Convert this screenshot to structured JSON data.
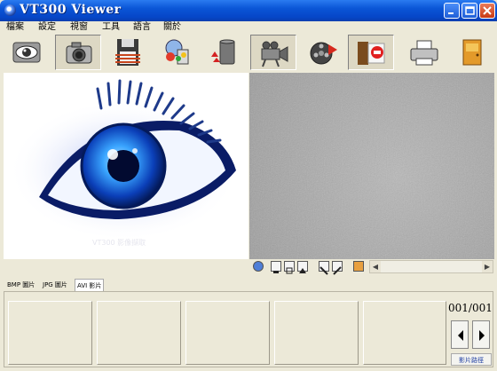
{
  "window": {
    "title": "VT300 Viewer"
  },
  "menu": [
    "檔案",
    "設定",
    "視窗",
    "工具",
    "語言",
    "關於"
  ],
  "toolbar": {
    "tools": [
      {
        "icon": "eye-view-icon",
        "pressed": false
      },
      {
        "icon": "camera-icon",
        "pressed": true
      },
      {
        "icon": "floppy-disk-icon",
        "pressed": false
      },
      {
        "icon": "recycle-bin-icon",
        "pressed": false
      },
      {
        "icon": "movie-camera-icon",
        "pressed": true
      },
      {
        "icon": "film-record-icon",
        "pressed": false
      },
      {
        "icon": "film-stop-icon",
        "pressed": true
      },
      {
        "icon": "printer-icon",
        "pressed": false
      },
      {
        "icon": "exit-door-icon",
        "pressed": false
      }
    ]
  },
  "preview": {
    "caption": "VT300 影像擷取"
  },
  "tabs": [
    "BMP 圖片",
    "JPG 圖片",
    "AVI 影片"
  ],
  "thumbnails": {
    "page_counter": "001/001",
    "path_button": "影片路徑"
  }
}
